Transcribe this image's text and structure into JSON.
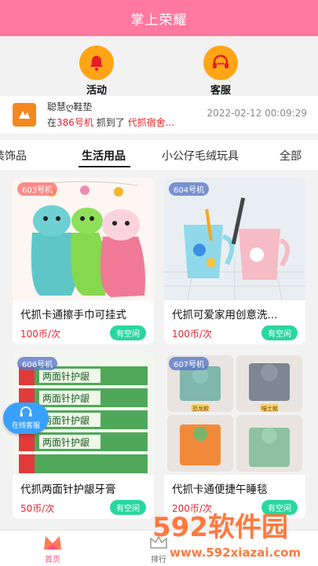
{
  "header": {
    "title": "掌上荣耀"
  },
  "actions": [
    {
      "label": "活动",
      "icon": "bell-icon"
    },
    {
      "label": "客服",
      "icon": "headset-icon"
    }
  ],
  "notice": {
    "user": "聪慧ღ鞋垫",
    "prefix": "在",
    "machine": "386号机",
    "middle": " 抓到了 ",
    "item": "代抓宿舍...",
    "time": "2022-02-12 00:09:29"
  },
  "tabs": [
    {
      "label": "装饰品",
      "active": false
    },
    {
      "label": "生活用品",
      "active": true
    },
    {
      "label": "小公仔毛绒玩具",
      "active": false
    },
    {
      "label": "全部",
      "active": false
    }
  ],
  "products": [
    {
      "badge": "603号机",
      "name": "代抓卡通擦手巾可挂式",
      "price": "100币/次",
      "status": "有空闲"
    },
    {
      "badge": "604号机",
      "name": "代抓可爱家用创意洗...",
      "price": "100币/次",
      "status": "有空闲"
    },
    {
      "badge": "606号机",
      "name": "代抓两面针护龈牙膏",
      "price": "50币/次",
      "status": "有空闲",
      "box_text": "两面针护龈"
    },
    {
      "badge": "607号机",
      "name": "代抓卡通便捷午睡毯",
      "price": "200币/次",
      "status": "有空闲",
      "tags": [
        "恐龙款",
        "喵士款"
      ]
    }
  ],
  "floating": {
    "label": "在线客服"
  },
  "nav": [
    {
      "label": "首页",
      "active": true
    },
    {
      "label": "排行",
      "active": false
    }
  ],
  "watermark": {
    "brand": "592软件园",
    "url": "www.592xiazai.com"
  },
  "colors": {
    "header": "#ff78a0",
    "accent": "#ffa516",
    "status": "#29d7a0",
    "price": "#e5242c"
  }
}
